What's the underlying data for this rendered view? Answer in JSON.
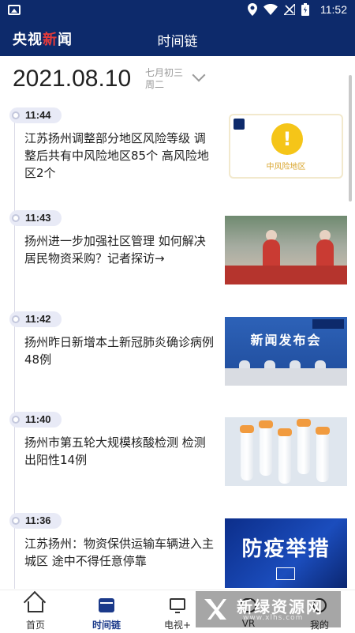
{
  "status_bar": {
    "time": "11:52"
  },
  "header": {
    "logo_part1": "央视",
    "logo_part2": "新",
    "logo_part3": "闻",
    "title": "时间链"
  },
  "date_bar": {
    "date": "2021.08.10",
    "lunar_date": "七月初三",
    "weekday": "周二"
  },
  "timeline": [
    {
      "time": "11:44",
      "headline": "江苏扬州调整部分地区风险等级 调整后共有中风险地区85个 高风险地区2个",
      "thumbnail_caption": "中风险地区",
      "thumbnail_symbol": "!"
    },
    {
      "time": "11:43",
      "headline": "扬州进一步加强社区管理 如何解决居民物资采购？记者探访→"
    },
    {
      "time": "11:42",
      "headline": "扬州昨日新增本土新冠肺炎确诊病例48例",
      "thumbnail_banner": "新闻发布会"
    },
    {
      "time": "11:40",
      "headline": "扬州市第五轮大规模核酸检测 检测出阳性14例"
    },
    {
      "time": "11:36",
      "headline": "江苏扬州：物资保供运输车辆进入主城区 途中不得任意停靠",
      "thumbnail_banner": "防疫举措"
    }
  ],
  "bottom_nav": [
    {
      "label": "首页",
      "icon": "home-icon"
    },
    {
      "label": "时间链",
      "icon": "calendar-icon",
      "active": true
    },
    {
      "label": "电视+",
      "icon": "tv-icon"
    },
    {
      "label": "VR",
      "icon": "vr-icon"
    },
    {
      "label": "我的",
      "icon": "profile-icon"
    }
  ],
  "watermark": {
    "text": "新绿资源网",
    "url": "www.xlhs.com"
  },
  "colors": {
    "brand_navy": "#0d2a6b",
    "accent_red": "#e33b3b",
    "active_nav": "#1b3a8a"
  }
}
